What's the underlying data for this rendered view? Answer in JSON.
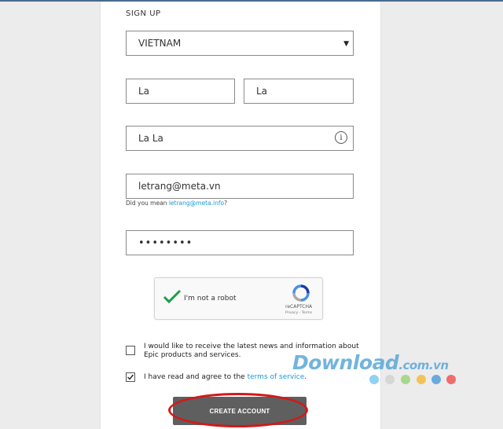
{
  "form": {
    "title": "SIGN UP",
    "country": "VIETNAM",
    "first_name": "La",
    "last_name": "La",
    "display_name": "La La",
    "info_icon": "i",
    "email": "letrang@meta.vn",
    "hint_prefix": "Did you mean ",
    "hint_suggestion": "letrang@meta.info",
    "hint_suffix": "?",
    "password_mask": "••••••••"
  },
  "captcha": {
    "label": "I'm not a robot",
    "brand": "reCAPTCHA",
    "links": "Privacy - Terms"
  },
  "consent": {
    "news_text": "I would like to receive the latest news and information about Epic products and services.",
    "terms_prefix": "I have read and agree to the ",
    "terms_link": "terms of service",
    "terms_suffix": "."
  },
  "create_button": "CREATE ACCOUNT",
  "watermark": {
    "main": "Download",
    "suffix": ".com.vn",
    "dot_colors": [
      "#8fd2f2",
      "#d6d6d6",
      "#a8d88c",
      "#f4c25a",
      "#6aa9e0",
      "#f06c6c"
    ]
  },
  "colors": {
    "accent": "#1a9ad6",
    "check": "#1e9e4e",
    "button": "#5f5f5f",
    "highlight": "#d41818"
  }
}
